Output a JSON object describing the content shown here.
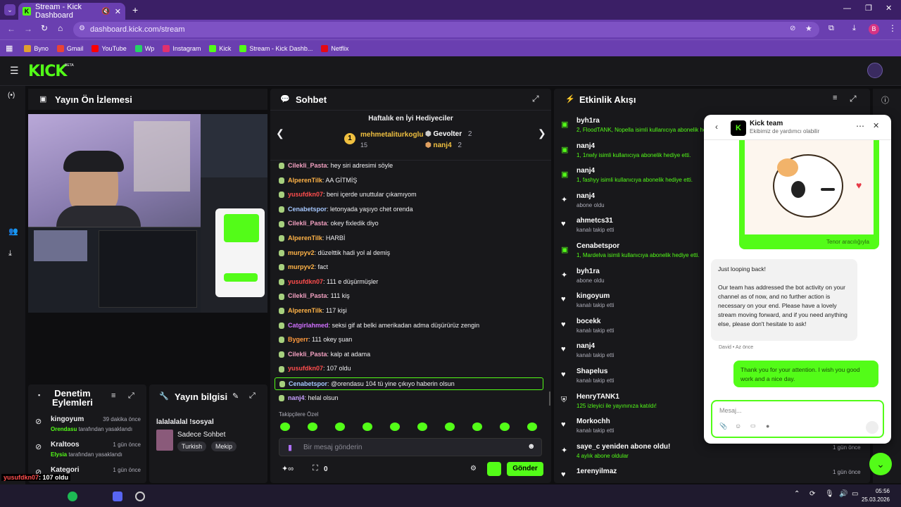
{
  "browser": {
    "tab_title": "Stream - Kick Dashboard",
    "url": "dashboard.kick.com/stream",
    "profile_initial": "B",
    "bookmarks": [
      {
        "label": "Byno",
        "color": "#e0a030"
      },
      {
        "label": "Gmail",
        "color": "#ea4335"
      },
      {
        "label": "YouTube",
        "color": "#ff0000"
      },
      {
        "label": "Wp",
        "color": "#25d366"
      },
      {
        "label": "Instagram",
        "color": "#e1306c"
      },
      {
        "label": "Kick",
        "color": "#53fc18"
      },
      {
        "label": "Stream - Kick Dashb...",
        "color": "#53fc18"
      },
      {
        "label": "Netflix",
        "color": "#e50914"
      }
    ]
  },
  "kick": {
    "logo": "KICK",
    "beta": "BETA"
  },
  "preview": {
    "title": "Yayın Ön İzlemesi"
  },
  "chat": {
    "title": "Sohbet",
    "gifters_title": "Haftalık en İyi Hediyeciler",
    "top_gifter": {
      "name": "mehmetaliturkoglu",
      "count": "15",
      "rank": "1"
    },
    "gifters": [
      {
        "name": "Gevolter",
        "count": "2"
      },
      {
        "name": "nanj4",
        "count": "2"
      }
    ],
    "messages": [
      {
        "user": "Cilekli_Pasta",
        "color": "#f2a0c0",
        "text": "hey siri adresimi söyle"
      },
      {
        "user": "AlperenTilk",
        "color": "#ffb347",
        "text": "AA GİTMİŞ"
      },
      {
        "user": "yusufdkn07",
        "color": "#ff4d4d",
        "text": "beni içerde unuttular çıkamıyom"
      },
      {
        "user": "Cenabetspor",
        "color": "#a6c8ff",
        "text": "letonyada yaşıyo chet orenda"
      },
      {
        "user": "Cilekli_Pasta",
        "color": "#f2a0c0",
        "text": "okey fixledik diyo"
      },
      {
        "user": "AlperenTilk",
        "color": "#ffb347",
        "text": "HARBİ"
      },
      {
        "user": "murpyv2",
        "color": "#ffb347",
        "text": "düzelttik hadi yol al demiş"
      },
      {
        "user": "murpyv2",
        "color": "#ffb347",
        "text": "fact"
      },
      {
        "user": "yusufdkn07",
        "color": "#ff4d4d",
        "text": "111 e düşürmüşler"
      },
      {
        "user": "Cilekli_Pasta",
        "color": "#f2a0c0",
        "text": "111 kiş"
      },
      {
        "user": "AlperenTilk",
        "color": "#ffb347",
        "text": "117 kişi"
      },
      {
        "user": "Catgirlahmed",
        "color": "#d070ff",
        "text": "seksi gif at belki amerikadan adma düşürürüz zengin"
      },
      {
        "user": "Bygerr",
        "color": "#ff9a3d",
        "text": "111 okey şuan"
      },
      {
        "user": "Cilekli_Pasta",
        "color": "#f2a0c0",
        "text": "kalp at adama"
      },
      {
        "user": "yusufdkn07",
        "color": "#ff4d4d",
        "text": "107 oldu"
      },
      {
        "user": "Cenabetspor",
        "color": "#a6c8ff",
        "text": "@orendasu 104 tü yine çıkıyo haberin olsun"
      },
      {
        "user": "nanj4",
        "color": "#c8a0ff",
        "text": "helal olsun"
      }
    ],
    "emote_label": "Takipçilere Özel",
    "input_placeholder": "Bir mesaj gönderin",
    "points": "0",
    "send_label": "Gönder"
  },
  "activity": {
    "title": "Etkinlik Akışı",
    "items": [
      {
        "icon": "gift",
        "name": "byh1ra",
        "sub": "2, FloodTANK, Nopella isimli kullanıcıya abonelik hediye etti.",
        "time": ""
      },
      {
        "icon": "gift",
        "name": "nanj4",
        "sub": "1, 1nwly isimli kullanıcıya abonelik hediye etti.",
        "time": ""
      },
      {
        "icon": "gift",
        "name": "nanj4",
        "sub": "1, fashyy isimli kullanıcıya abonelik hediye etti.",
        "time": ""
      },
      {
        "icon": "star",
        "name": "nanj4",
        "sub": "abone oldu",
        "time": ""
      },
      {
        "icon": "heart",
        "name": "ahmetcs31",
        "sub": "kanalı takip etti",
        "time": ""
      },
      {
        "icon": "gift",
        "name": "Cenabetspor",
        "sub": "1, Mardelva isimli kullanıcıya abonelik hediye etti.",
        "time": ""
      },
      {
        "icon": "star",
        "name": "byh1ra",
        "sub": "abone oldu",
        "time": ""
      },
      {
        "icon": "heart",
        "name": "kingoyum",
        "sub": "kanalı takip etti",
        "time": ""
      },
      {
        "icon": "heart",
        "name": "bocekk",
        "sub": "kanalı takip etti",
        "time": ""
      },
      {
        "icon": "heart",
        "name": "nanj4",
        "sub": "kanalı takip etti",
        "time": ""
      },
      {
        "icon": "heart",
        "name": "Shapelus",
        "sub": "kanalı takip etti",
        "time": ""
      },
      {
        "icon": "raid",
        "name": "HenryTANK1",
        "sub": "125 izleyici ile yayınınıza katıldı!",
        "time": ""
      },
      {
        "icon": "heart",
        "name": "Morkochh",
        "sub": "kanalı takip etti",
        "time": "1 gün önce"
      },
      {
        "icon": "star",
        "name": "saye_c yeniden abone oldu!",
        "sub": "4 aylık abone oldular",
        "time": "1 gün önce"
      },
      {
        "icon": "heart",
        "name": "1erenyilmaz",
        "sub": "",
        "time": "1 gün önce"
      }
    ]
  },
  "mod": {
    "title_line1": "Denetim",
    "title_line2": "Eylemleri",
    "items": [
      {
        "name": "kingoyum",
        "time": "39 dakika önce",
        "actor": "Orendasu",
        "action": "tarafından yasaklandı"
      },
      {
        "name": "Kraltoos",
        "time": "1 gün önce",
        "actor": "Elysia",
        "action": "tarafından yasaklandı"
      },
      {
        "name": "Kategori",
        "time": "1 gün önce",
        "actor": "",
        "action": ""
      }
    ]
  },
  "streaminfo": {
    "title": "Yayın bilgisi",
    "stream_title": "lalalalalal !sosyal",
    "category": "Sadece Sohbet",
    "tags": [
      "Turkish",
      "Mekip"
    ]
  },
  "support": {
    "title": "Kick team",
    "subtitle": "Ekibimiz de yardımcı olabilir",
    "gif_credit": "Tenor aracılığıyla",
    "agent_msg1": "Just looping back!",
    "agent_msg2": "Our team has addressed the bot activity on your channel as of now, and no further action is necessary on your end. Please have a lovely stream moving forward, and if you need anything else, please don't hesitate to ask!",
    "agent_meta": "David • Az önce",
    "user_msg": "Thank you for your attention. I wish you good work and a nice day.",
    "input_placeholder": "Mesaj..."
  },
  "overlay": {
    "line1_user": "yusufdkn07",
    "line1_text": ": 107 oldu",
    "line2_user": "Cenabetspor",
    "line2_text": ": @orendasu 104 tü yine çıkıyo haberin olsun",
    "line3_user": "nanj4",
    "line3_text": ": helal olsun"
  },
  "clock": {
    "time": "05:56",
    "date": "25.03.2026"
  }
}
